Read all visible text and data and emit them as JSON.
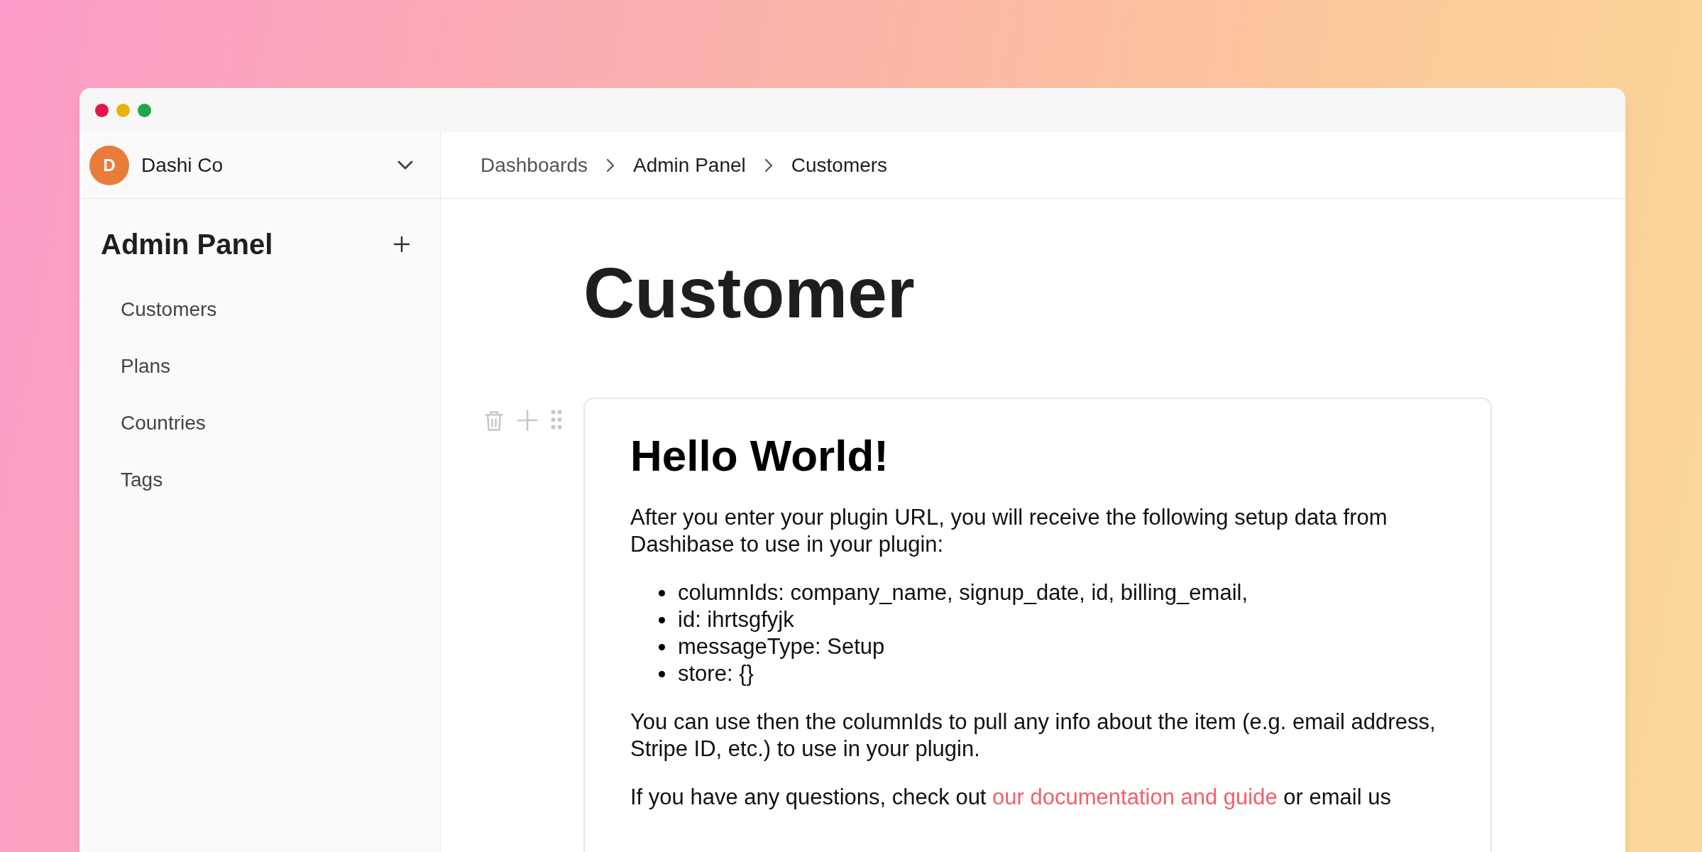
{
  "workspace": {
    "avatar_letter": "D",
    "name": "Dashi Co"
  },
  "breadcrumbs": [
    "Dashboards",
    "Admin Panel",
    "Customers"
  ],
  "sidebar": {
    "title": "Admin Panel",
    "items": [
      {
        "label": "Customers"
      },
      {
        "label": "Plans"
      },
      {
        "label": "Countries"
      },
      {
        "label": "Tags"
      }
    ]
  },
  "page": {
    "title": "Customer"
  },
  "card": {
    "heading": "Hello World!",
    "blocks": [
      {
        "kind": "paragraph",
        "text": "After you enter your plugin URL, you will receive the following setup data from Dashibase to use in your plugin:"
      },
      {
        "kind": "list",
        "items": [
          "columnIds: company_name, signup_date, id, billing_email,",
          "id: ihrtsgfyjk",
          "messageType: Setup",
          "store: {}"
        ]
      },
      {
        "kind": "paragraph",
        "text": "You can use then the columnIds to pull any info about the item (e.g. email address, Stripe ID, etc.) to use in your plugin."
      },
      {
        "kind": "link_paragraph",
        "before": "If you have any questions, check out",
        "link": "our documentation and guide",
        "after": "or email us"
      }
    ]
  }
}
